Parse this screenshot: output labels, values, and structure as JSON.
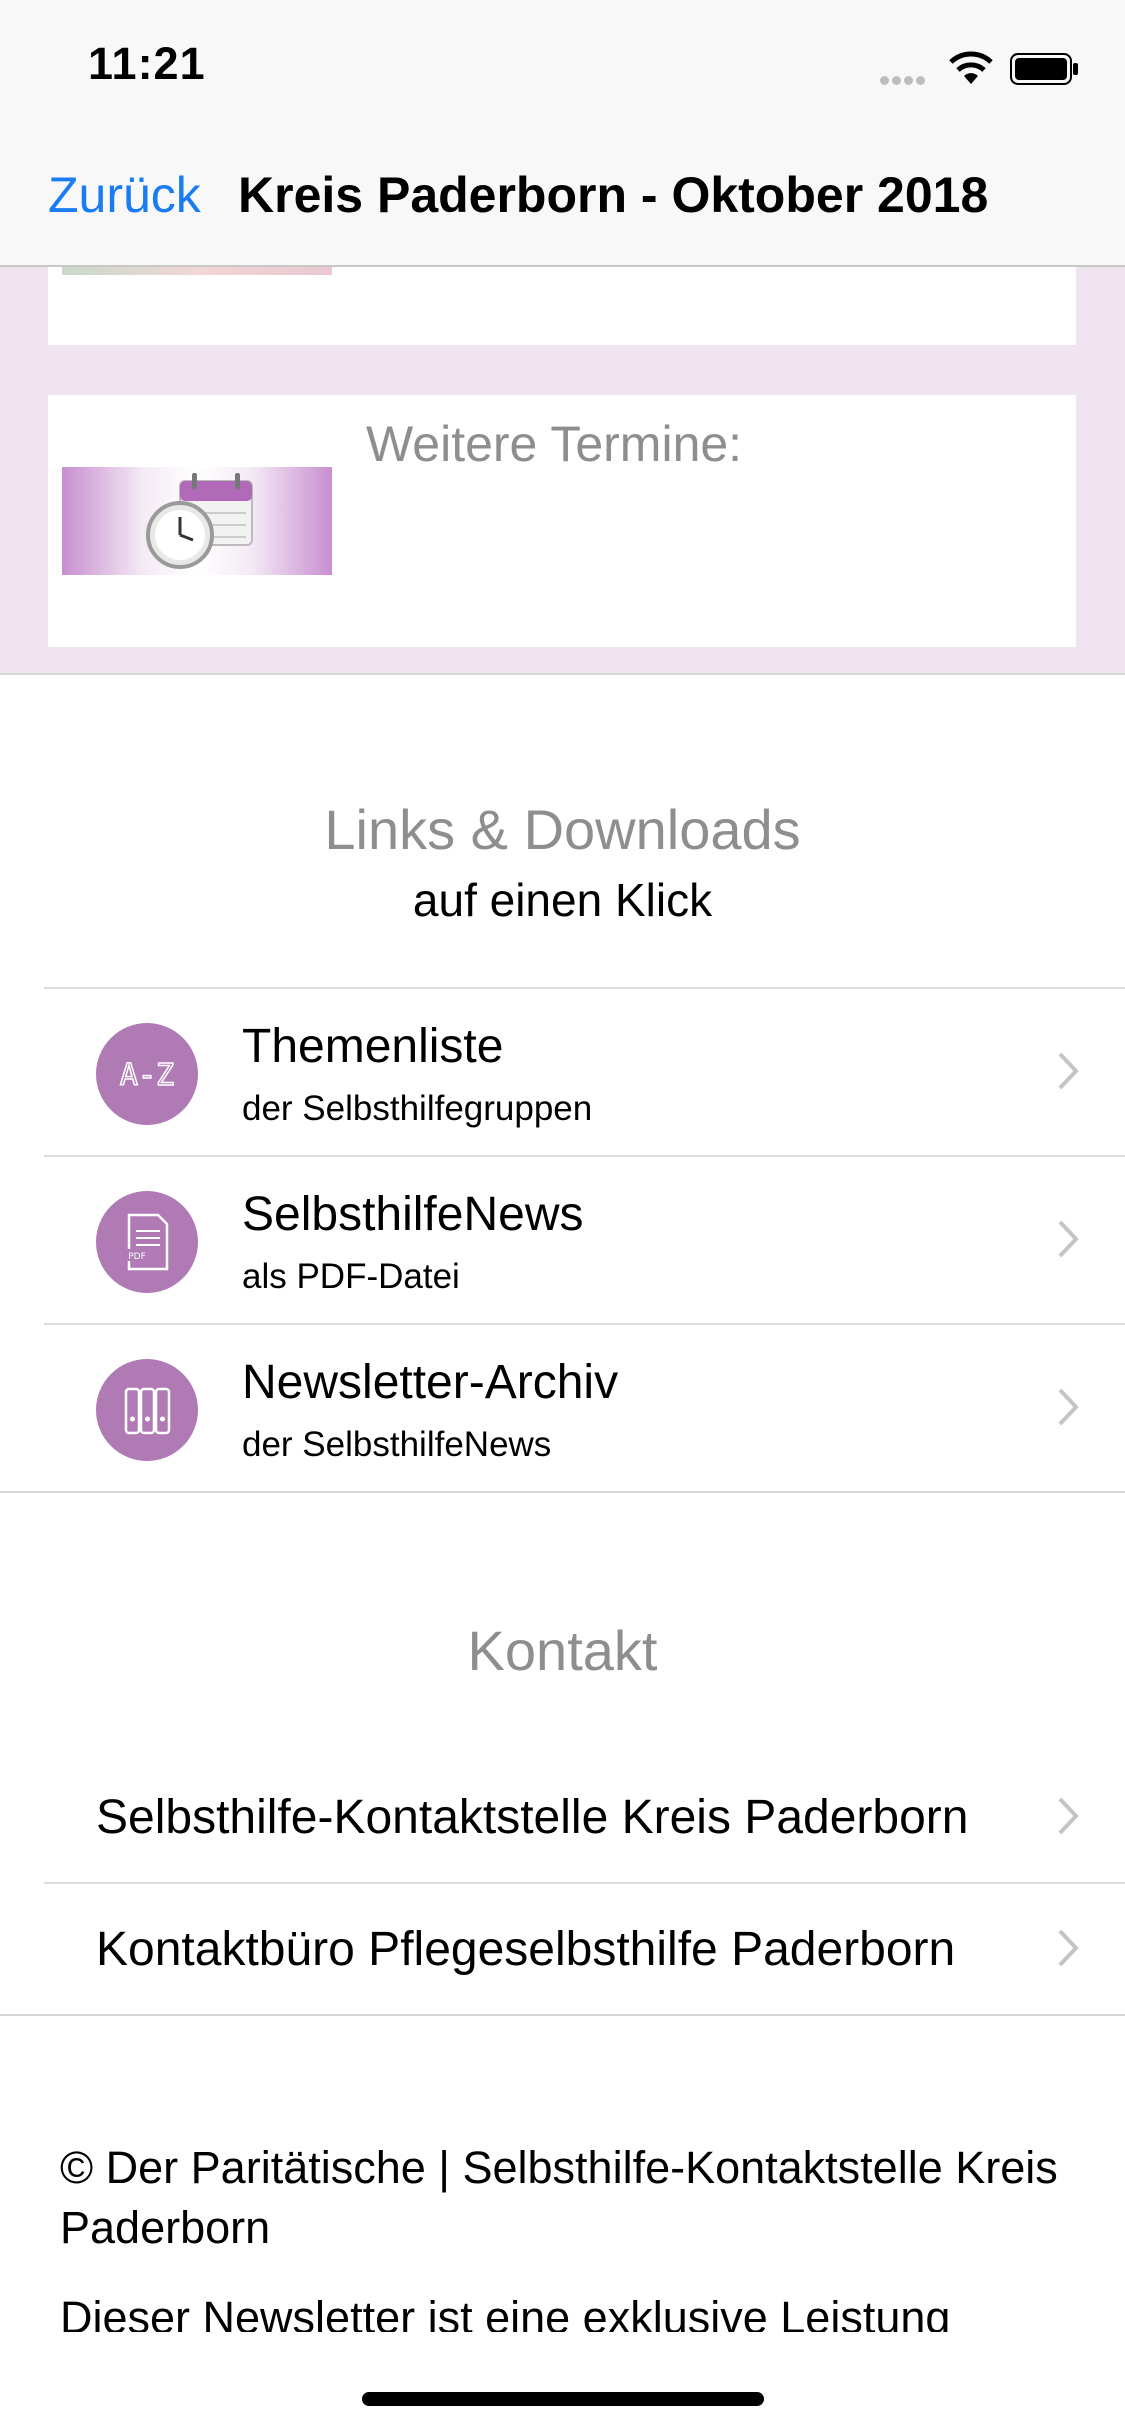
{
  "status": {
    "time": "11:21"
  },
  "nav": {
    "back": "Zurück",
    "title": "Kreis Paderborn - Oktober 2018"
  },
  "termine": {
    "label": "Weitere Termine:"
  },
  "links": {
    "title": "Links & Downloads",
    "subtitle": "auf einen Klick",
    "items": [
      {
        "title": "Themenliste",
        "subtitle": "der Selbsthilfegruppen",
        "icon": "a-z-icon"
      },
      {
        "title": "SelbsthilfeNews",
        "subtitle": "als PDF-Datei",
        "icon": "pdf-icon"
      },
      {
        "title": "Newsletter-Archiv",
        "subtitle": "der SelbsthilfeNews",
        "icon": "binders-icon"
      }
    ]
  },
  "kontakt": {
    "title": "Kontakt",
    "items": [
      {
        "label": "Selbsthilfe-Kontaktstelle Kreis Paderborn"
      },
      {
        "label": "Kontaktbüro Pflegeselbsthilfe Paderborn"
      }
    ]
  },
  "footer": {
    "copyright": "© Der Paritätische | Selbsthilfe-Kontaktstelle Kreis Paderborn",
    "note": "Dieser Newsletter ist eine exklusive Leistung"
  },
  "colors": {
    "accent": "#1a7cf2",
    "icon_bg": "#b07bb5",
    "lavender": "#efe4f0"
  }
}
